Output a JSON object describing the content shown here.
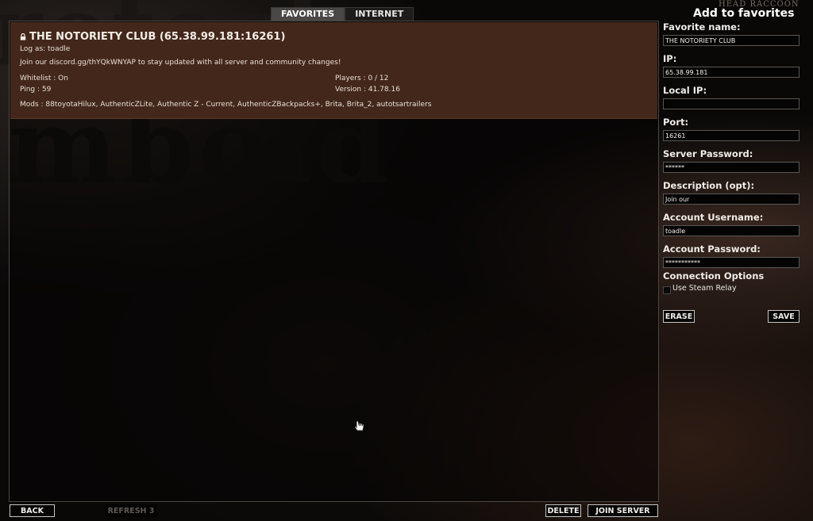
{
  "tabs": [
    {
      "label": "FAVORITES",
      "active": true
    },
    {
      "label": "INTERNET",
      "active": false
    }
  ],
  "server": {
    "title": "THE NOTORIETY CLUB (65.38.99.181:16261)",
    "log_as": "Log as: toadle",
    "description": "Join our discord.gg/thYQkWNYAP to stay updated with all server and community changes!",
    "whitelist": "Whitelist : On",
    "ping": "Ping : 59",
    "players": "Players : 0 / 12",
    "version": "Version : 41.78.16",
    "mods": "Mods : 88toyotaHilux, AuthenticZLite, Authentic Z - Current, AuthenticZBackpacks+, Brita, Brita_2, autotsartrailers"
  },
  "background": {
    "logo_top": "rotect",
    "logo_mid": "mboid",
    "corner_mark": "HEAD RACCOON"
  },
  "favorite_form": {
    "title": "Add to favorites",
    "favorite_name_label": "Favorite name:",
    "favorite_name_value": "THE NOTORIETY CLUB",
    "ip_label": "IP:",
    "ip_value": "65.38.99.181",
    "local_ip_label": "Local IP:",
    "local_ip_value": "",
    "port_label": "Port:",
    "port_value": "16261",
    "server_password_label": "Server Password:",
    "server_password_value": "******",
    "description_label": "Description (opt):",
    "description_value": "Join our",
    "account_username_label": "Account Username:",
    "account_username_value": "toadle",
    "account_password_label": "Account Password:",
    "account_password_value": "***********",
    "connection_options_label": "Connection Options",
    "steam_relay_label": "Use Steam Relay",
    "steam_relay_checked": false,
    "erase_label": "ERASE",
    "save_label": "SAVE"
  },
  "footer": {
    "back_label": "BACK",
    "refresh_label": "REFRESH 3",
    "delete_label": "DELETE",
    "join_label": "JOIN SERVER"
  }
}
